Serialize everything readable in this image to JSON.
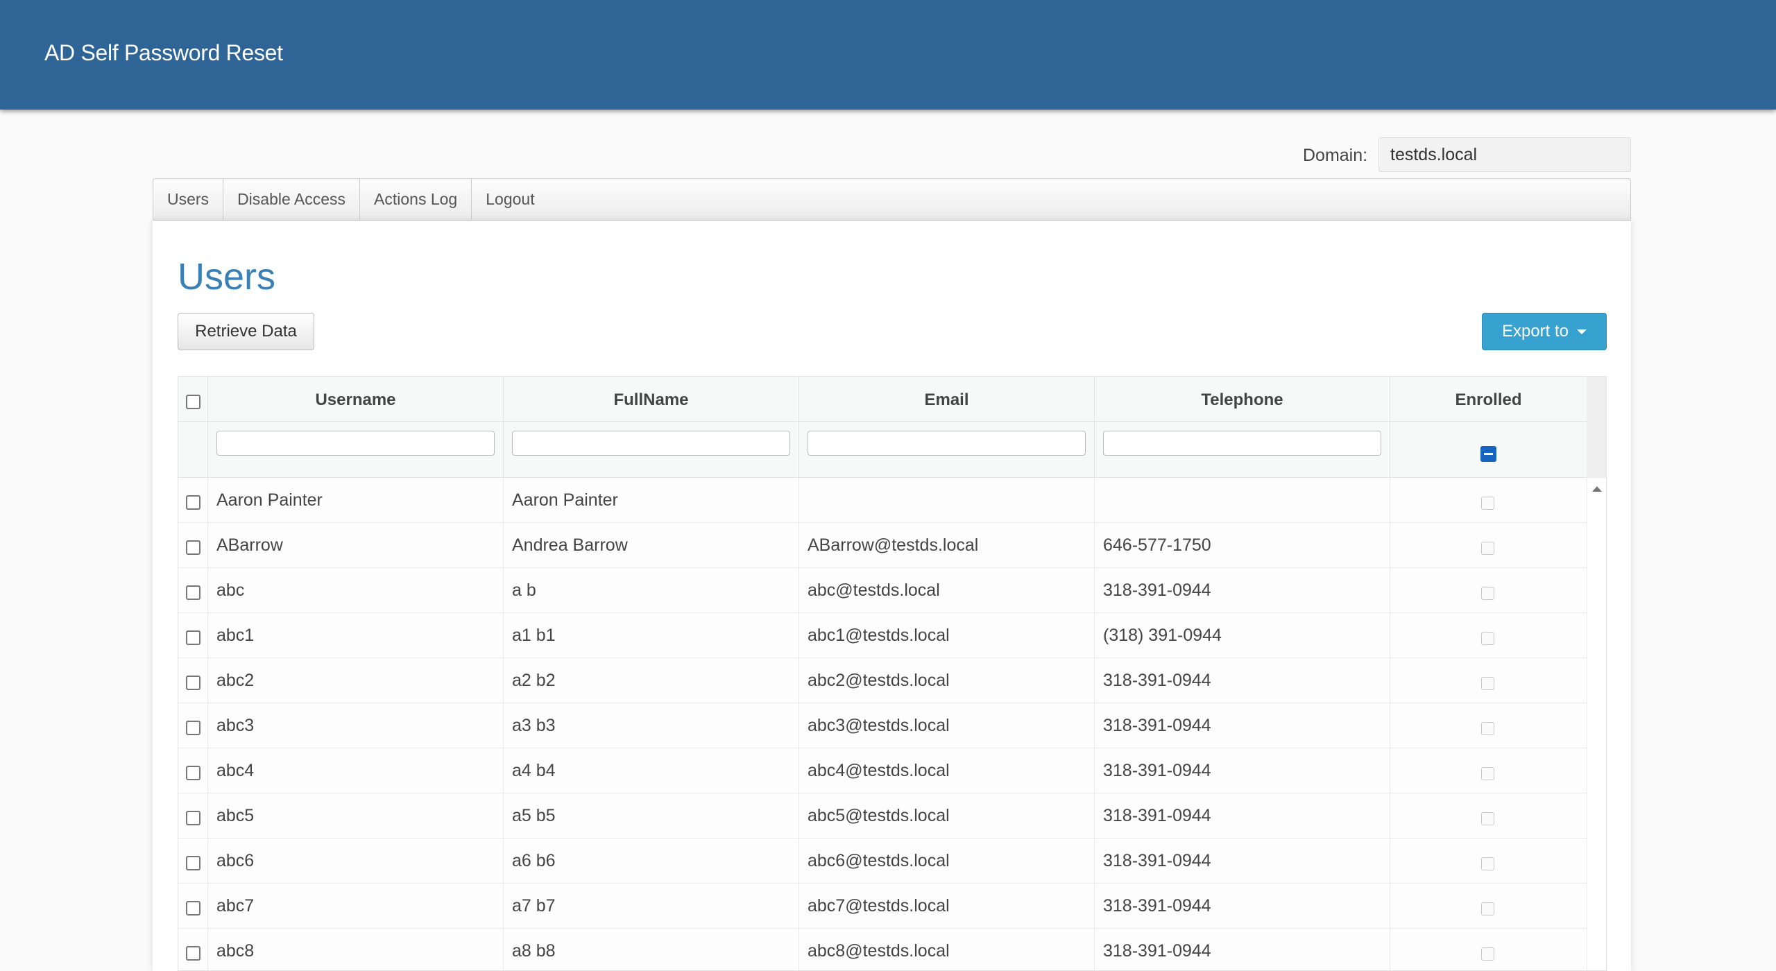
{
  "app": {
    "title": "AD Self Password Reset"
  },
  "domain": {
    "label": "Domain:",
    "value": "testds.local"
  },
  "nav": {
    "tabs": [
      "Users",
      "Disable Access",
      "Actions Log",
      "Logout"
    ]
  },
  "page": {
    "title": "Users"
  },
  "toolbar": {
    "retrieve_label": "Retrieve Data",
    "export_label": "Export to"
  },
  "table": {
    "columns": [
      "Username",
      "FullName",
      "Email",
      "Telephone",
      "Enrolled"
    ],
    "rows": [
      {
        "username": "Aaron Painter",
        "fullname": "Aaron Painter",
        "email": "",
        "telephone": "",
        "enrolled": false
      },
      {
        "username": "ABarrow",
        "fullname": "Andrea Barrow",
        "email": "ABarrow@testds.local",
        "telephone": "646-577-1750",
        "enrolled": false
      },
      {
        "username": "abc",
        "fullname": "a b",
        "email": "abc@testds.local",
        "telephone": "318-391-0944",
        "enrolled": false
      },
      {
        "username": "abc1",
        "fullname": "a1 b1",
        "email": "abc1@testds.local",
        "telephone": "(318) 391-0944",
        "enrolled": false
      },
      {
        "username": "abc2",
        "fullname": "a2 b2",
        "email": "abc2@testds.local",
        "telephone": "318-391-0944",
        "enrolled": false
      },
      {
        "username": "abc3",
        "fullname": "a3 b3",
        "email": "abc3@testds.local",
        "telephone": "318-391-0944",
        "enrolled": false
      },
      {
        "username": "abc4",
        "fullname": "a4 b4",
        "email": "abc4@testds.local",
        "telephone": "318-391-0944",
        "enrolled": false
      },
      {
        "username": "abc5",
        "fullname": "a5 b5",
        "email": "abc5@testds.local",
        "telephone": "318-391-0944",
        "enrolled": false
      },
      {
        "username": "abc6",
        "fullname": "a6 b6",
        "email": "abc6@testds.local",
        "telephone": "318-391-0944",
        "enrolled": false
      },
      {
        "username": "abc7",
        "fullname": "a7 b7",
        "email": "abc7@testds.local",
        "telephone": "318-391-0944",
        "enrolled": false
      },
      {
        "username": "abc8",
        "fullname": "a8 b8",
        "email": "abc8@testds.local",
        "telephone": "318-391-0944",
        "enrolled": false
      }
    ]
  },
  "colors": {
    "header_bg": "#2e6496",
    "title_color": "#3a80b5",
    "export_bg": "#37a2cf",
    "enrolled_filter": "#1565c0"
  }
}
